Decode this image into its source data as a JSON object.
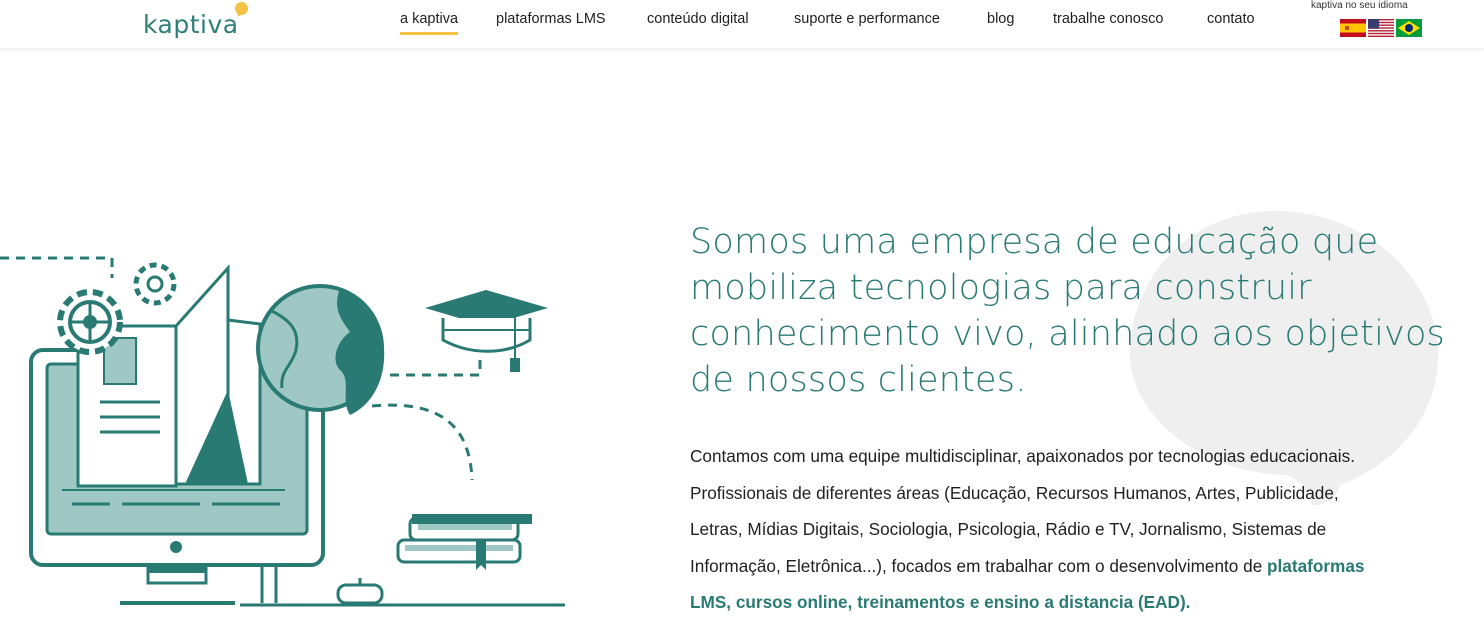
{
  "header": {
    "logo_text": "kaptiva",
    "nav": [
      {
        "label": "a kaptiva",
        "active": true
      },
      {
        "label": "plataformas LMS",
        "active": false
      },
      {
        "label": "conteúdo digital",
        "active": false
      },
      {
        "label": "suporte e performance",
        "active": false
      },
      {
        "label": "blog",
        "active": false
      },
      {
        "label": "trabalhe conosco",
        "active": false
      },
      {
        "label": "contato",
        "active": false
      }
    ],
    "language_label": "kaptiva no seu idioma",
    "flags": [
      "spain-flag-icon",
      "usa-flag-icon",
      "brazil-flag-icon"
    ]
  },
  "hero": {
    "title_lines": [
      "Somos uma empresa de educação que",
      "mobiliza tecnologias para construir",
      "conhecimento vivo, alinhado aos objetivos",
      "de nossos clientes."
    ],
    "body_lines": [
      "Contamos com uma equipe multidisciplinar, apaixonados por tecnologias educacionais.",
      "Profissionais de diferentes áreas (Educação, Recursos Humanos, Artes, Publicidade,",
      "Letras, Mídias Digitais, Sociologia, Psicologia, Rádio e TV, Jornalismo, Sistemas de",
      "Informação, Eletrônica...), focados em trabalhar com o desenvolvimento de "
    ],
    "body_bold_a": "plataformas",
    "body_bold_b": "LMS, cursos online, treinamentos e ensino a distancia (EAD)."
  },
  "colors": {
    "brand_teal": "#2a7a74",
    "accent_yellow": "#f6c244",
    "illustration_light": "#9fc8c4",
    "quote_gray": "#eeeeee"
  },
  "illustration": {
    "icons": [
      "computer-monitor-icon",
      "open-book-icon",
      "gear-icon",
      "globe-icon",
      "graduation-cap-icon",
      "books-stack-icon"
    ]
  }
}
